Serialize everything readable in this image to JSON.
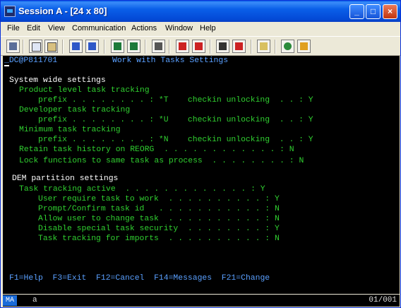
{
  "window": {
    "title": "Session A - [24 x 80]"
  },
  "menu": [
    "File",
    "Edit",
    "View",
    "Communication",
    "Actions",
    "Window",
    "Help"
  ],
  "toolbar_icons": [
    "print-screen-icon",
    "copy-icon",
    "paste-icon",
    "send-icon",
    "receive-icon",
    "display-icon",
    "keypad-icon",
    "macro-icon",
    "record-macro-icon",
    "stop-macro-icon",
    "play-macro-icon",
    "pause-macro-icon",
    "clipboard-icon",
    "globe-icon",
    "help-icon"
  ],
  "screen": {
    "header_id": "_DC@P811701",
    "header_title": "Work with Tasks Settings",
    "system_heading": "System wide settings",
    "product_label": "Product level task tracking",
    "product_prefix_line": "prefix . . . . . . . . : *T    checkin unlocking  . . : Y",
    "developer_label": "Developer task tracking",
    "developer_prefix_line": "prefix . . . . . . . . : *U    checkin unlocking  . . : Y",
    "minimum_label": "Minimum task tracking",
    "minimum_prefix_line": "prefix . . . . . . . . : *N    checkin unlocking  . . : Y",
    "retain_line": "Retain task history on REORG  . . . . . . . . . . . . : N",
    "lock_line": "Lock functions to same task as process  . . . . . . . . : N",
    "dem_heading": "DEM partition settings",
    "tracking_active_line": "Task tracking active  . . . . . . . . . . . . . : Y",
    "user_require_line": "User require task to work  . . . . . . . . . . : Y",
    "prompt_confirm_line": "Prompt/Confirm task id   . . . . . . . . . . . : N",
    "allow_change_line": "Allow user to change task  . . . . . . . . . . : N",
    "disable_security_line": "Disable special task security  . . . . . . . . : Y",
    "imports_line": "Task tracking for imports  . . . . . . . . . . : N",
    "fkeys": "F1=Help  F3=Exit  F12=Cancel  F14=Messages  F21=Change"
  },
  "status": {
    "mode": "MA",
    "indicator": "a",
    "position": "01/001"
  },
  "colors": {
    "field_text": "#30d030",
    "heading_text": "#ffffff",
    "header_text": "#5aa0ff",
    "screen_bg": "#000000",
    "titlebar": "#0a5fe8"
  }
}
